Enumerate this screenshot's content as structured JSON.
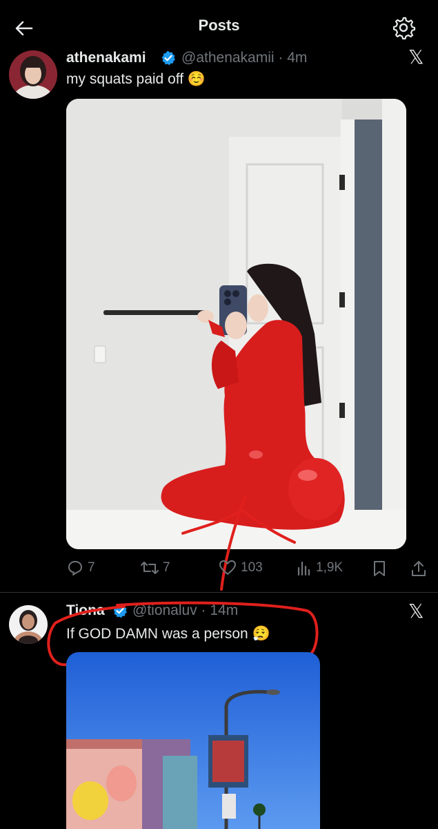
{
  "header": {
    "title": "Posts",
    "back_icon": "arrow-left-icon",
    "settings_icon": "gear-icon"
  },
  "post1": {
    "name": "athenakami",
    "handle": "@athenakamii · 4m",
    "text": "my squats paid off",
    "emoji": "☺️",
    "actions": {
      "reply": "7",
      "repost": "7",
      "like": "103",
      "views": "1,9K"
    }
  },
  "post2": {
    "name": "Tiona",
    "handle": "@tionaluv · 14m",
    "text": "If GOD DAMN was a person",
    "emoji": "😮‍💨"
  },
  "colors": {
    "verified": "#1d9bf0",
    "annotation": "#e0201c",
    "muted": "#71767b"
  }
}
